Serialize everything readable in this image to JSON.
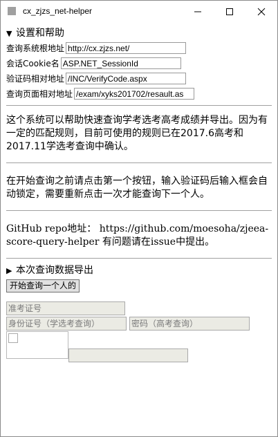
{
  "window": {
    "title": "cx_zjzs_net-helper"
  },
  "settings": {
    "summary": "设置和帮助",
    "fields": [
      {
        "label": "查询系统根地址",
        "value": "http://cx.zjzs.net/"
      },
      {
        "label": "会话Cookie名",
        "value": "ASP.NET_SessionId"
      },
      {
        "label": "验证码相对地址",
        "value": "/INC/VerifyCode.aspx"
      },
      {
        "label": "查询页面相对地址",
        "value": "/exam/xyks201702/resault.as"
      }
    ],
    "para1": "这个系统可以帮助快速查询学考选考高考成绩并导出。因为有一定的匹配规则，目前可使用的规则已在2017.6高考和2017.11学选考查询中确认。",
    "para2": "在开始查询之前请点击第一个按钮，输入验证码后输入框会自动锁定，需要重新点击一次才能查询下一个人。",
    "para3": "GitHub repo地址： https://github.com/moesoha/zjeea-score-query-helper 有问题请在issue中提出。"
  },
  "export": {
    "summary": "本次查询数据导出"
  },
  "query": {
    "start_button": "开始查询一个人的",
    "exam_id_placeholder": "准考证号",
    "id_card_placeholder": "身份证号（学选考查询）",
    "password_placeholder": "密码（高考查询）",
    "captcha_placeholder": ""
  }
}
